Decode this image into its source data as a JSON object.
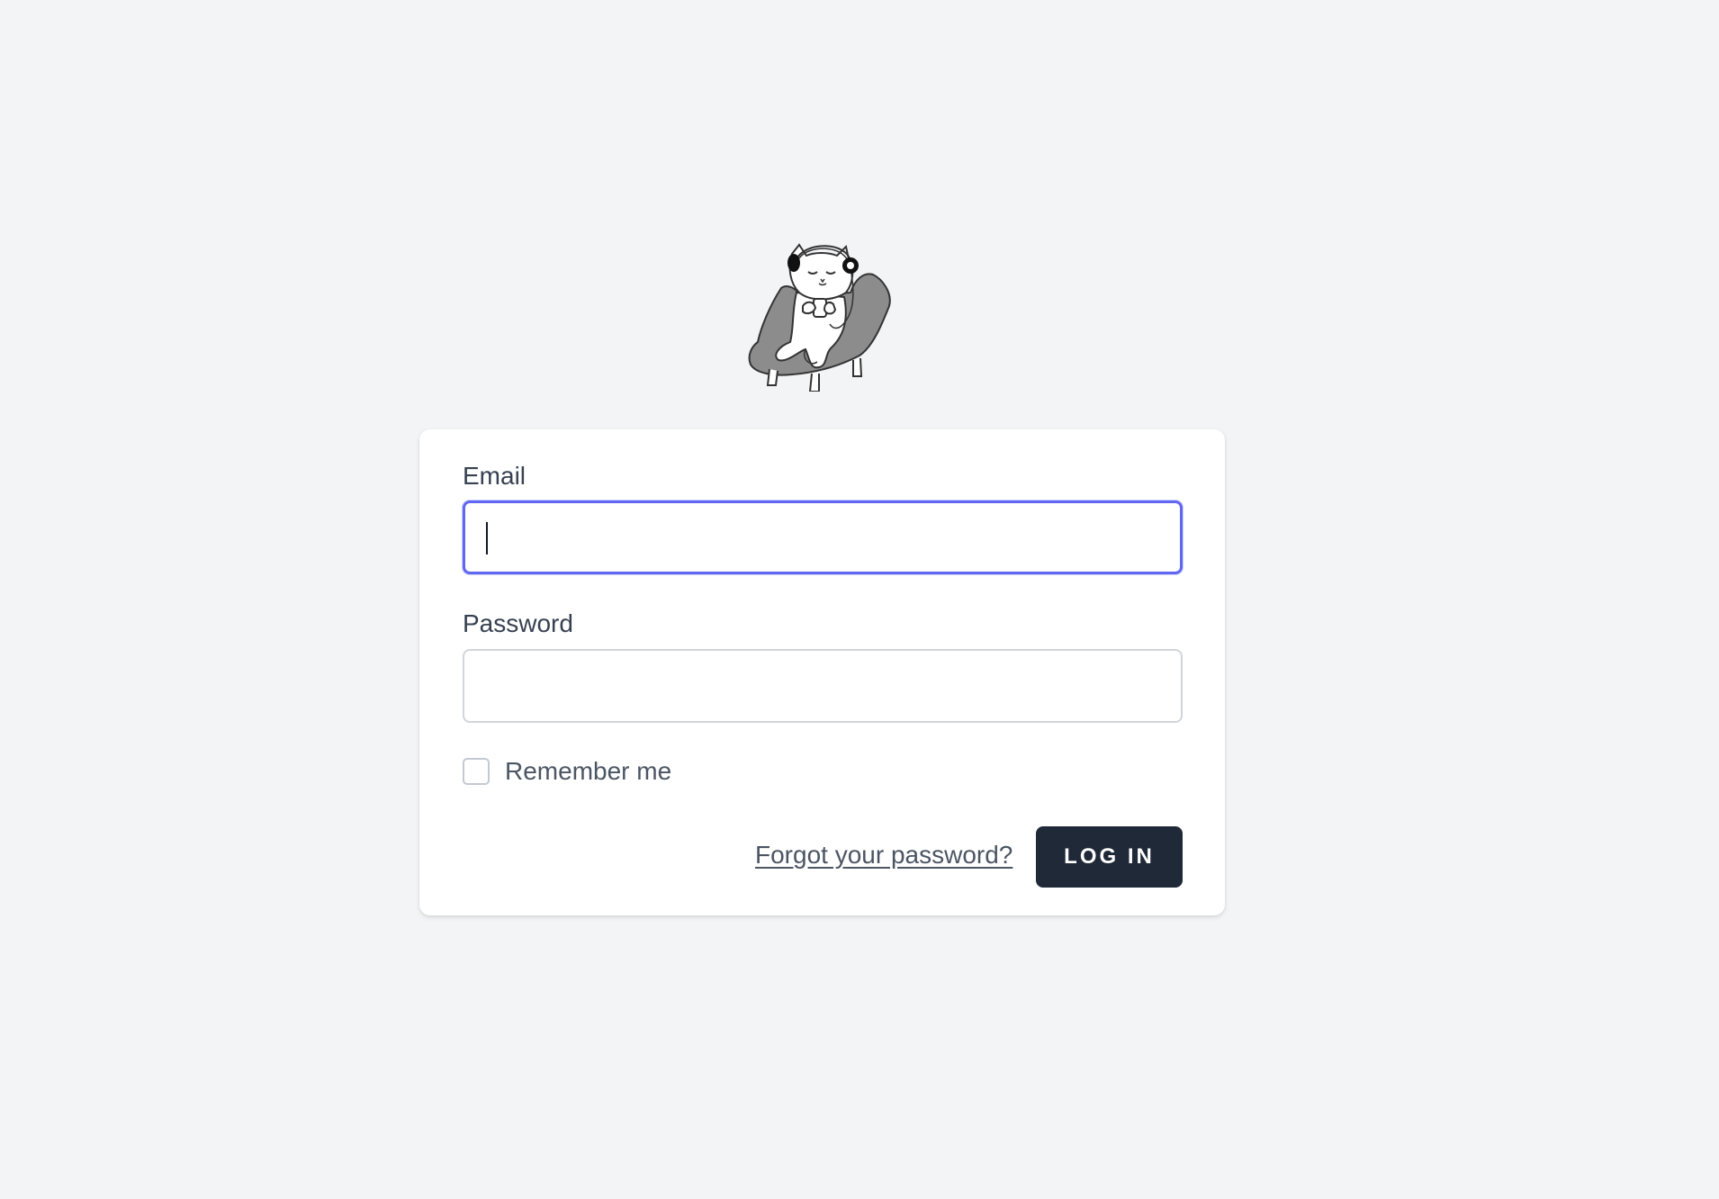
{
  "logo": {
    "icon": "cat-in-armchair-with-headphones-logo"
  },
  "login_form": {
    "email_label": "Email",
    "email_value": "",
    "password_label": "Password",
    "password_value": "",
    "remember_label": "Remember me",
    "remember_checked": false,
    "forgot_link": "Forgot your password?",
    "submit_label": "LOG IN"
  },
  "colors": {
    "background": "#f3f4f6",
    "focus_ring": "#6366f1",
    "button": "#1f2937"
  }
}
